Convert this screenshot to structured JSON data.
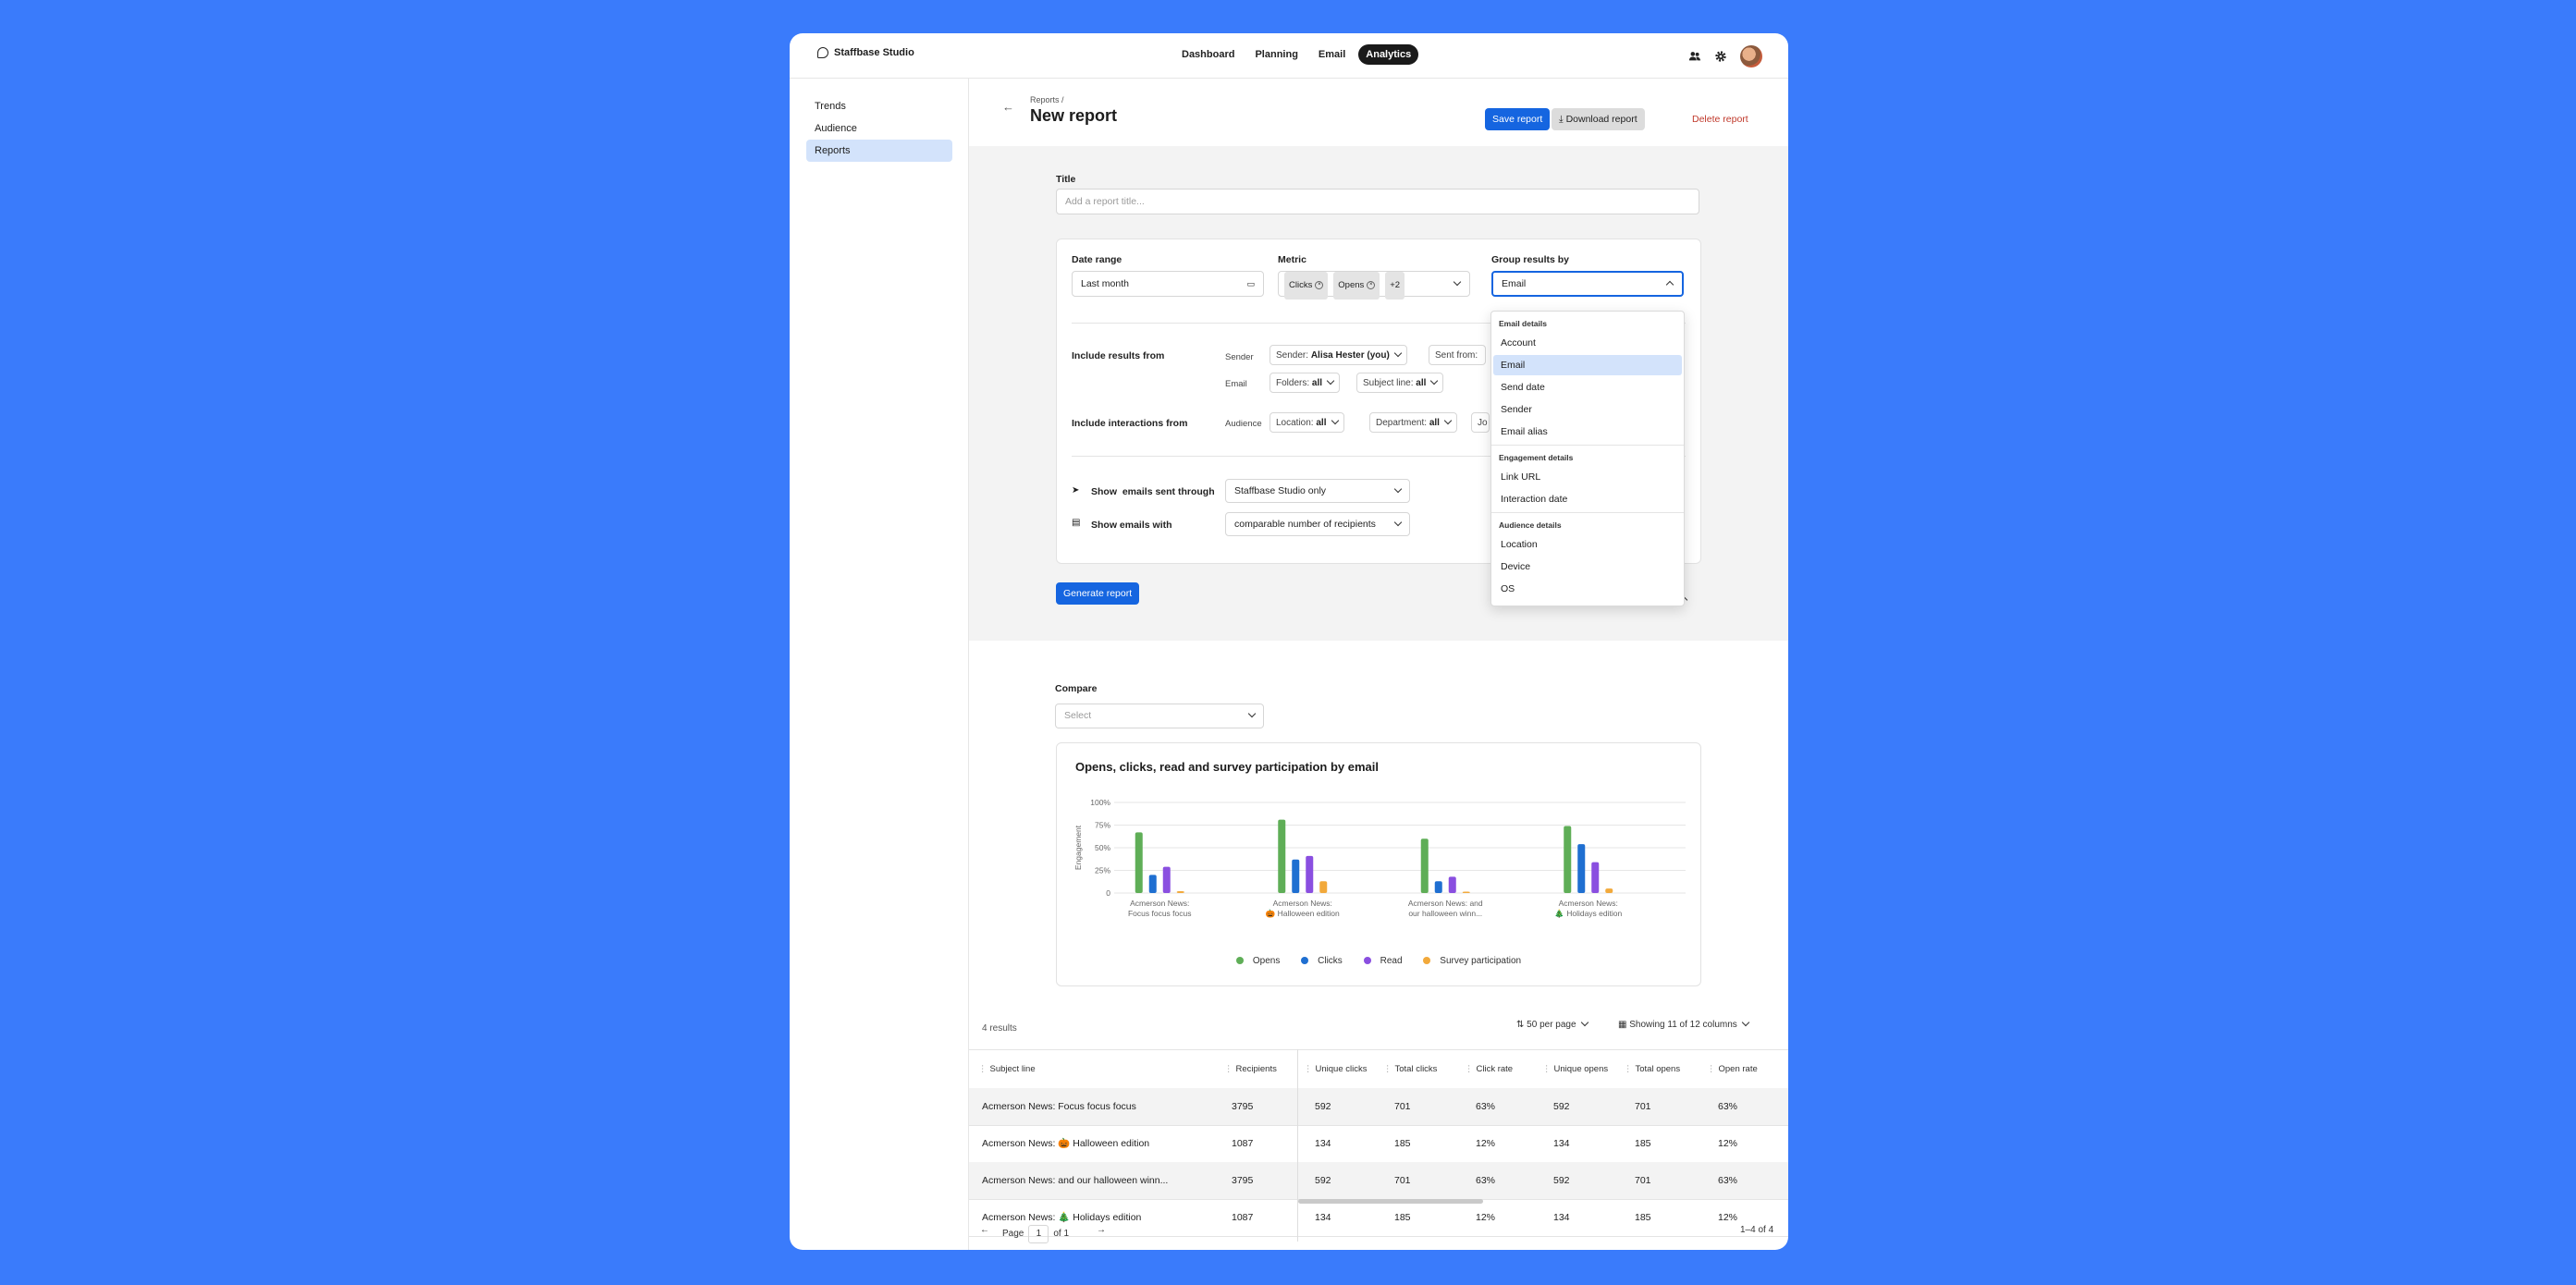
{
  "app": {
    "brand": "Staffbase Studio"
  },
  "nav": {
    "items": [
      "Dashboard",
      "Planning",
      "Email",
      "Analytics"
    ],
    "active": "Analytics"
  },
  "sidebar": {
    "items": [
      "Trends",
      "Audience",
      "Reports"
    ],
    "active": "Reports"
  },
  "header": {
    "breadcrumb": "Reports /",
    "title": "New report",
    "save_label": "Save report",
    "download_label": "Download report",
    "delete_label": "Delete report"
  },
  "form": {
    "title_label": "Title",
    "title_placeholder": "Add a report title...",
    "date_range_label": "Date range",
    "date_range_value": "Last month",
    "metric_label": "Metric",
    "metric_chips": [
      "Clicks",
      "Opens"
    ],
    "metric_more": "+2",
    "group_label": "Group results by",
    "group_value": "Email",
    "include_results_label": "Include results from",
    "sender_label": "Sender",
    "sender_filter_prefix": "Sender:",
    "sender_filter_value": "Alisa Hester (you)",
    "sent_from_label": "Sent from:",
    "email_label": "Email",
    "folders_prefix": "Folders:",
    "folders_value": "all",
    "subject_prefix": "Subject line:",
    "subject_value": "all",
    "include_interactions_label": "Include interactions from",
    "audience_label": "Audience",
    "location_prefix": "Location:",
    "location_value": "all",
    "department_prefix": "Department:",
    "department_value": "all",
    "extra_pill": "Jo",
    "show_sent_prefix": "Show",
    "show_sent_label": "emails sent through",
    "show_sent_value": "Staffbase Studio only",
    "show_with_label": "Show emails with",
    "show_with_value": "comparable number of recipients",
    "generate_label": "Generate report"
  },
  "dropdown": {
    "groups": [
      {
        "heading": "Email details",
        "items": [
          "Account",
          "Email",
          "Send date",
          "Sender",
          "Email alias"
        ]
      },
      {
        "heading": "Engagement details",
        "items": [
          "Link URL",
          "Interaction date"
        ]
      },
      {
        "heading": "Audience details",
        "items": [
          "Location",
          "Device",
          "OS"
        ]
      }
    ],
    "selected": "Email"
  },
  "compare": {
    "label": "Compare",
    "placeholder": "Select"
  },
  "colors": {
    "opens": "#5fae57",
    "clicks": "#1f6fd1",
    "read": "#8a4fe0",
    "survey": "#f2a93b",
    "accent": "#1565e0"
  },
  "chart_data": {
    "type": "bar",
    "title": "Opens, clicks, read and survey participation by email",
    "ylabel": "Engagement",
    "yticks": [
      "100%",
      "75%",
      "50%",
      "25%",
      "0"
    ],
    "ylim": [
      0,
      100
    ],
    "categories": [
      [
        "Acmerson News:",
        "Focus focus focus"
      ],
      [
        "Acmerson News:",
        "🎃 Halloween edition"
      ],
      [
        "Acmerson News: and",
        "our halloween winn..."
      ],
      [
        "Acmerson News:",
        "🎄 Holidays edition"
      ]
    ],
    "series": [
      {
        "name": "Opens",
        "values": [
          67,
          81,
          60,
          74
        ]
      },
      {
        "name": "Clicks",
        "values": [
          20,
          37,
          13,
          54
        ]
      },
      {
        "name": "Read",
        "values": [
          29,
          41,
          18,
          34
        ]
      },
      {
        "name": "Survey participation",
        "values": [
          2,
          13,
          0,
          5
        ]
      }
    ],
    "legend": "bottom"
  },
  "table": {
    "results_count": "4 results",
    "per_page": "50 per page",
    "columns_shown": "Showing 11 of 12 columns",
    "columns": [
      "Subject line",
      "Recipients",
      "Unique clicks",
      "Total clicks",
      "Click rate",
      "Unique opens",
      "Total opens",
      "Open rate"
    ],
    "rows": [
      [
        "Acmerson News: Focus focus focus",
        "3795",
        "592",
        "701",
        "63%",
        "592",
        "701",
        "63%"
      ],
      [
        "Acmerson News: 🎃 Halloween edition",
        "1087",
        "134",
        "185",
        "12%",
        "134",
        "185",
        "12%"
      ],
      [
        "Acmerson News: and our halloween winn...",
        "3795",
        "592",
        "701",
        "63%",
        "592",
        "701",
        "63%"
      ],
      [
        "Acmerson News: 🎄 Holidays edition",
        "1087",
        "134",
        "185",
        "12%",
        "134",
        "185",
        "12%"
      ]
    ]
  },
  "pager": {
    "page_label": "Page",
    "page": "1",
    "of": "of 1",
    "range": "1–4 of 4"
  }
}
